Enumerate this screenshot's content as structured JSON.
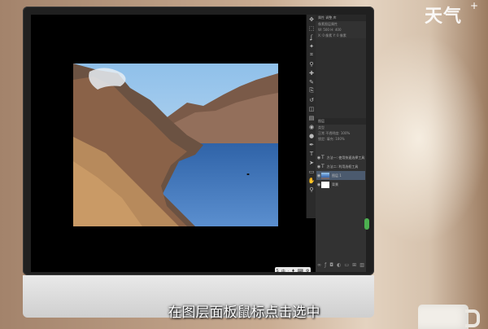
{
  "watermark": {
    "brand": "天气",
    "plus": "+"
  },
  "caption": "在图层面板鼠标点击选中",
  "photoshop": {
    "tools": [
      "move-icon",
      "marquee-icon",
      "lasso-icon",
      "wand-icon",
      "crop-icon",
      "eyedropper-icon",
      "heal-icon",
      "brush-icon",
      "stamp-icon",
      "history-icon",
      "eraser-icon",
      "gradient-icon",
      "blur-icon",
      "dodge-icon",
      "pen-icon",
      "type-icon",
      "path-select-icon",
      "shape-icon",
      "hand-icon",
      "zoom-icon"
    ],
    "panel": {
      "top_rows": [
        "属性 调整 库",
        "像素图层属性",
        "W: 500   H: 400",
        "X: 0 像素   Y: 0 像素"
      ],
      "layers_tab": "图层",
      "layer_rows": [
        "类型",
        "正常   不透明度: 100%",
        "锁定:   填充: 100%"
      ],
      "layers": [
        {
          "name": "方法一: 使用快速选择工具"
        },
        {
          "name": "方法二: 利用选框工具"
        },
        {
          "name": "图层 1",
          "selected": true
        },
        {
          "name": "背景"
        }
      ],
      "taskbar": [
        "S",
        "中",
        "·",
        "♦",
        "⌨",
        "⚙"
      ]
    }
  },
  "colors": {
    "selected_layer": "#4b5a6e",
    "lake": "#3f73bd",
    "sky": "#9cc7ea"
  }
}
